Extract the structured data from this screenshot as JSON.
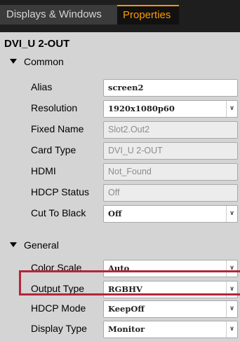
{
  "tabs": [
    {
      "label": "Displays & Windows",
      "active": false
    },
    {
      "label": "Properties",
      "active": true
    }
  ],
  "title": "DVI_U 2-OUT",
  "sections": {
    "common": "Common",
    "general": "General"
  },
  "common_rows": [
    {
      "label": "Alias",
      "value": "screen2",
      "type": "text"
    },
    {
      "label": "Resolution",
      "value": "1920x1080p60",
      "type": "dropdown"
    },
    {
      "label": "Fixed Name",
      "value": "Slot2.Out2",
      "type": "readonly"
    },
    {
      "label": "Card Type",
      "value": "DVI_U 2-OUT",
      "type": "readonly"
    },
    {
      "label": "HDMI",
      "value": "Not_Found",
      "type": "readonly"
    },
    {
      "label": "HDCP Status",
      "value": "Off",
      "type": "readonly"
    },
    {
      "label": "Cut To Black",
      "value": "Off",
      "type": "dropdown"
    }
  ],
  "general_rows": [
    {
      "label": "Color Scale",
      "value": "Auto",
      "type": "dropdown"
    },
    {
      "label": "Output Type",
      "value": "RGBHV",
      "type": "dropdown"
    },
    {
      "label": "HDCP Mode",
      "value": "KeepOff",
      "type": "dropdown"
    },
    {
      "label": "Display Type",
      "value": "Monitor",
      "type": "dropdown"
    }
  ],
  "dropdown_icon": "chevron-down-icon",
  "colors": {
    "tab_active_text": "#ff9900",
    "tab_bar_bg": "#1e1e1e",
    "panel_bg": "#d4d4d4",
    "highlight": "#b3263a"
  }
}
